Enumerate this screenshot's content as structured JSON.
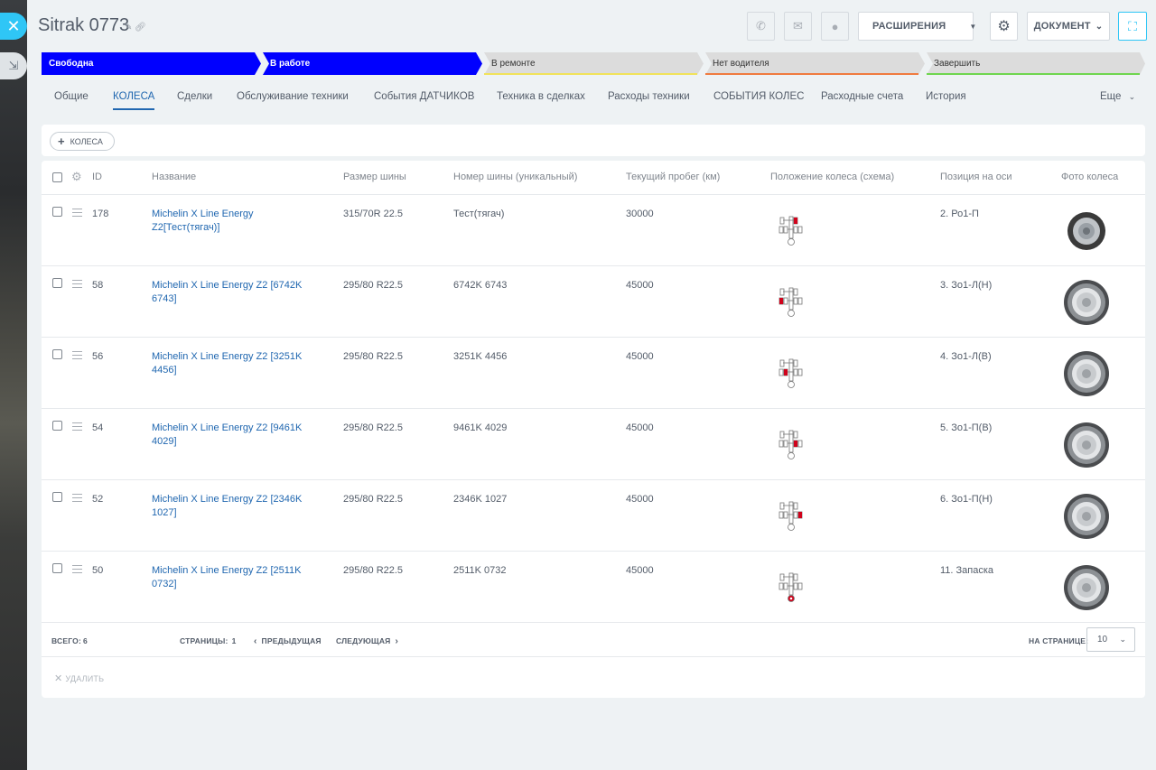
{
  "window": {
    "close_icon": "close-icon",
    "collapse_icon": "collapse-icon"
  },
  "header": {
    "title": "Sitrak 0773",
    "extensions_label": "РАСШИРЕНИЯ",
    "document_label": "ДОКУМЕНТ"
  },
  "stages": [
    {
      "label": "Свободна",
      "color": "#0000ff",
      "text_color": "#ffffff"
    },
    {
      "label": "В работе",
      "color": "#0000ff",
      "text_color": "#ffffff"
    },
    {
      "label": "В ремонте",
      "color": "#dcdcdc",
      "text_color": "#333333",
      "underline": "#f1e35a"
    },
    {
      "label": "Нет водителя",
      "color": "#dcdcdc",
      "text_color": "#333333",
      "underline": "#f07b3f"
    },
    {
      "label": "Завершить",
      "color": "#dcdcdc",
      "text_color": "#333333",
      "underline": "#6fd64f"
    }
  ],
  "tabs": [
    {
      "label": "Общие"
    },
    {
      "label": "КОЛЕСА",
      "active": true
    },
    {
      "label": "Сделки"
    },
    {
      "label": "Обслуживание техники"
    },
    {
      "label": "События ДАТЧИКОВ"
    },
    {
      "label": "Техника в сделках"
    },
    {
      "label": "Расходы техники"
    },
    {
      "label": "СОБЫТИЯ КОЛЕС"
    },
    {
      "label": "Расходные счета"
    },
    {
      "label": "История"
    }
  ],
  "more_tab": "Еще",
  "toolbar": {
    "add_label": "КОЛЕСА"
  },
  "grid": {
    "columns": [
      "ID",
      "Название",
      "Размер шины",
      "Номер шины (уникальный)",
      "Текущий пробег (км)",
      "Положение колеса (схема)",
      "Позиция на оси",
      "Фото колеса"
    ],
    "rows": [
      {
        "id": "178",
        "name": "Michelin X Line Energy Z2[Тест(тягач)]",
        "size": "315/70R 22.5",
        "number": "Тест(тягач)",
        "mileage": "30000",
        "position": "2. Ро1-П",
        "scheme": "front-right",
        "photo": "tire-photo-sidewall"
      },
      {
        "id": "58",
        "name": "Michelin X Line Energy Z2 [6742K 6743]",
        "size": "295/80 R22.5",
        "number": "6742K 6743",
        "mileage": "45000",
        "position": "3. Зо1-Л(Н)",
        "scheme": "rear-left-outer",
        "photo": "tire-photo-tread"
      },
      {
        "id": "56",
        "name": "Michelin X Line Energy Z2 [3251K 4456]",
        "size": "295/80 R22.5",
        "number": "3251K 4456",
        "mileage": "45000",
        "position": "4. Зо1-Л(В)",
        "scheme": "rear-left-inner",
        "photo": "tire-photo-tread"
      },
      {
        "id": "54",
        "name": "Michelin X Line Energy Z2 [9461K 4029]",
        "size": "295/80 R22.5",
        "number": "9461K 4029",
        "mileage": "45000",
        "position": "5. Зо1-П(В)",
        "scheme": "rear-right-inner",
        "photo": "tire-photo-tread"
      },
      {
        "id": "52",
        "name": "Michelin X Line Energy Z2 [2346K 1027]",
        "size": "295/80 R22.5",
        "number": "2346K 1027",
        "mileage": "45000",
        "position": "6. Зо1-П(Н)",
        "scheme": "rear-right-outer",
        "photo": "tire-photo-tread"
      },
      {
        "id": "50",
        "name": "Michelin X Line Energy Z2 [2511K 0732]",
        "size": "295/80 R22.5",
        "number": "2511K 0732",
        "mileage": "45000",
        "position": "11. Запаска",
        "scheme": "spare",
        "photo": "tire-photo-tread"
      }
    ]
  },
  "footer": {
    "total_label": "ВСЕГО:",
    "total_value": "6",
    "pages_label": "СТРАНИЦЫ:",
    "pages_value": "1",
    "prev_label": "ПРЕДЫДУЩАЯ",
    "next_label": "СЛЕДУЮЩАЯ",
    "per_page_label": "НА СТРАНИЦЕ:",
    "per_page_value": "10",
    "delete_label": "УДАЛИТЬ"
  }
}
